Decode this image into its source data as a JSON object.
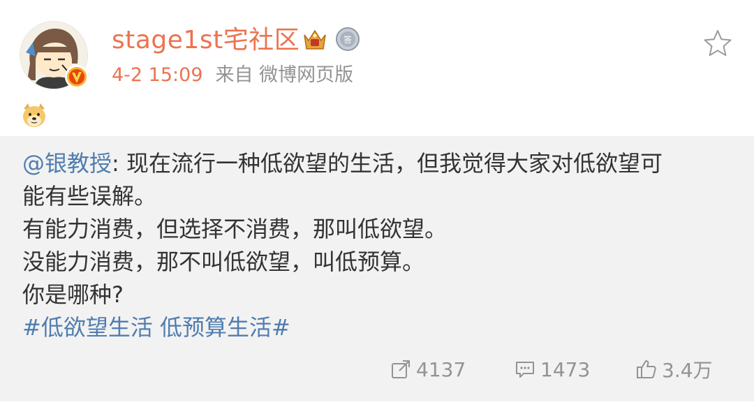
{
  "post": {
    "user_name": "stage1st宅社区",
    "time": "4-2 15:09",
    "source": "来自 微博网页版",
    "icons": {
      "avatar": "cartoon-avatar",
      "verified": "verified-v-icon",
      "crown_badge": "crown-badge-icon",
      "medal_badge": "answer-medal-icon",
      "star": "star-outline-icon",
      "emoji": "doge-emoji"
    }
  },
  "retweet": {
    "mention": "@银教授",
    "line1_rest": ": 现在流行一种低欲望的生活，但我觉得大家对低欲望可",
    "line2": "能有些误解。",
    "line3": "有能力消费，但选择不消费，那叫低欲望。",
    "line4": "没能力消费，那不叫低欲望，叫低预算。",
    "line5": "你是哪种?",
    "topic": "#低欲望生活 低预算生活#",
    "stats": {
      "reposts": "4137",
      "comments": "1473",
      "likes": "3.4万"
    },
    "icons": {
      "repost": "repost-icon",
      "comment": "comment-icon",
      "like": "thumbs-up-icon"
    }
  },
  "colors": {
    "accent_orange": "#eb7350",
    "link_blue": "#507daf",
    "gray_text": "#939393",
    "retweet_bg": "#f2f2f2"
  }
}
